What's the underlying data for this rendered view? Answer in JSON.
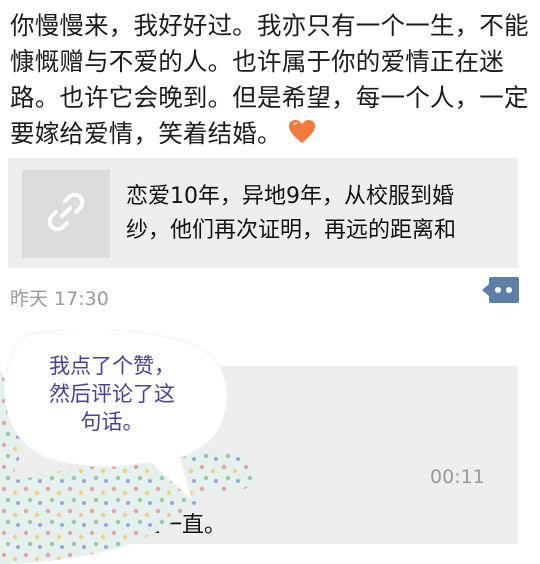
{
  "post": {
    "text": "你慢慢来，我好好过。我亦只有一个一生，不能慷慨赠与不爱的人。也许属于你的爱情正在迷路。也许它会晚到。但是希望，每一个人，一定要嫁给爱情，笑着结婚。",
    "emoji": "orange-heart-icon",
    "time": "昨天 17:30"
  },
  "link": {
    "title": "恋爱10年，异地9年，从校服到婚\n纱，他们再次证明，再远的距离和",
    "thumb_icon": "link-icon"
  },
  "comment": {
    "text": "愿好，一直一直。",
    "time": "00:11"
  },
  "overlay": {
    "note": "我点了个赞，\n然后评论了这\n句话。"
  },
  "colors": {
    "bubble_text": "#4a3fa0",
    "more_button": "#5b7fa6",
    "heart": "#f07a3a"
  }
}
